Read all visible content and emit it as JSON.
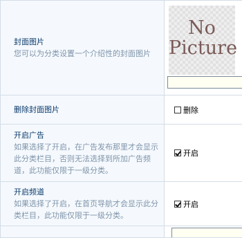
{
  "rows": [
    {
      "title": "封面图片",
      "desc": "您可以为分类设置一个介绍性的封面图片",
      "preview_line1": "No",
      "preview_line2": "Picture",
      "input_value": ""
    },
    {
      "title": "删除封面图片",
      "checkbox_label": "删除",
      "checked": false
    },
    {
      "title": "开启广告",
      "desc": "如果选择了开启，在广告发布那里才会显示此分类栏目，否则无法选择到所加广告频道，此功能仅限于一级分类。",
      "checkbox_label": "开启",
      "checked": true
    },
    {
      "title": "开启频道",
      "desc": "如果选择了开启，在首页导航才会显示此分类栏目，此功能仅限于一级分类。",
      "checkbox_label": "开启",
      "checked": true
    }
  ]
}
